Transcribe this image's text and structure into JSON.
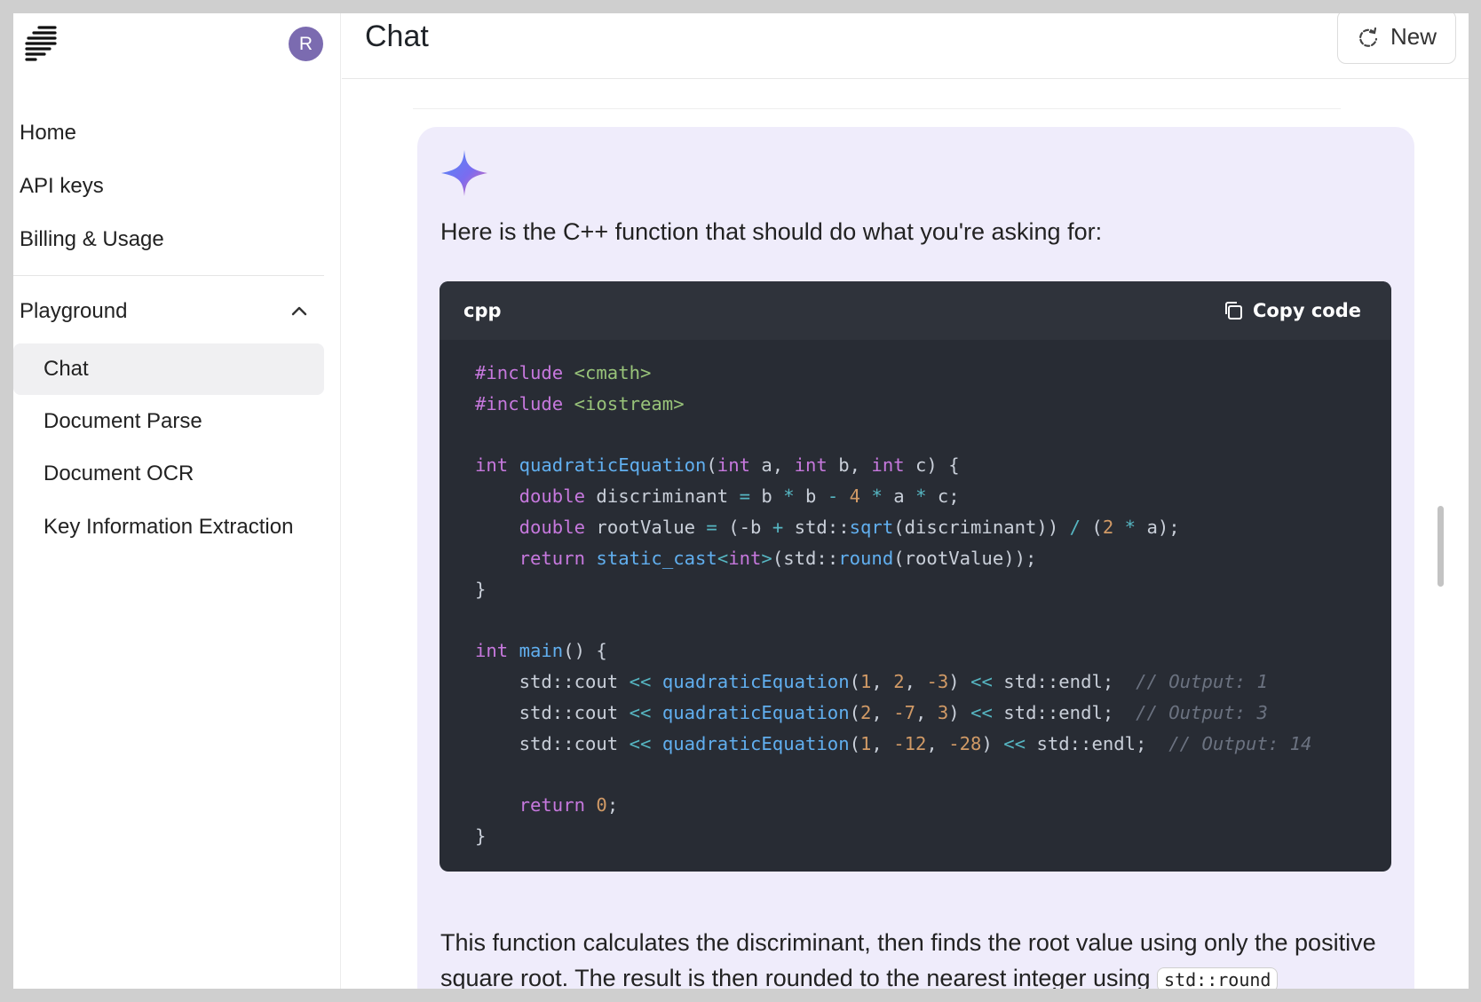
{
  "sidebar": {
    "avatar_initial": "R",
    "nav": [
      "Home",
      "API keys",
      "Billing & Usage"
    ],
    "section": {
      "label": "Playground",
      "expanded": true
    },
    "subitems": [
      {
        "label": "Chat",
        "active": true
      },
      {
        "label": "Document Parse"
      },
      {
        "label": "Document OCR"
      },
      {
        "label": "Key Information Extraction"
      }
    ]
  },
  "header": {
    "title": "Chat",
    "new_button": "New"
  },
  "message": {
    "intro": "Here is the C++ function that should do what you're asking for:",
    "code": {
      "language": "cpp",
      "copy_label": "Copy code"
    },
    "paragraph": "This function calculates the discriminant, then finds the root value using only the positive square root. The result is then rounded to the nearest integer using",
    "inline_code": "std::round"
  },
  "colors": {
    "accent": "#7b6bb0",
    "card_bg": "#efecfb",
    "code_bg": "#282c34"
  }
}
